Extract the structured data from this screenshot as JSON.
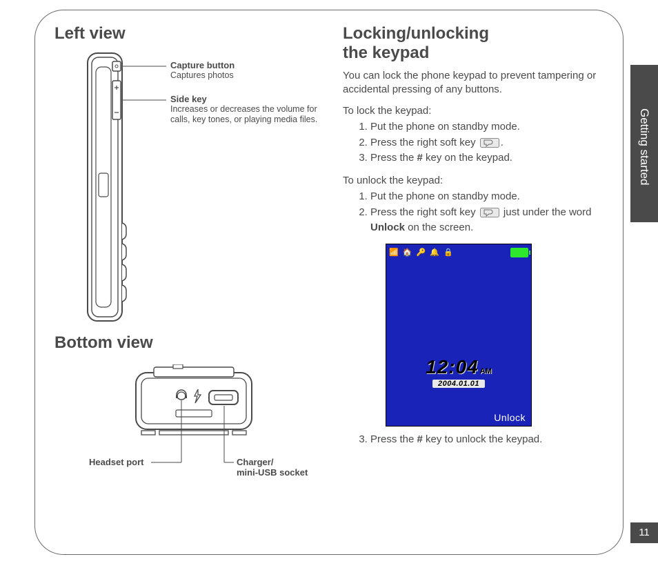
{
  "side_tab": "Getting started",
  "page_number": "11",
  "left_col": {
    "heading_left_view": "Left view",
    "capture": {
      "title": "Capture button",
      "desc": "Captures photos"
    },
    "side_key": {
      "title": "Side key",
      "desc": "Increases or decreases the volume for calls, key tones, or playing media files."
    },
    "heading_bottom_view": "Bottom view",
    "headset_port_label": "Headset port",
    "charger_label_line1": "Charger/",
    "charger_label_line2": "mini-USB socket"
  },
  "right_col": {
    "heading_line1": "Locking/unlocking",
    "heading_line2": "the keypad",
    "intro": "You can lock the phone keypad to prevent tampering or accidental pressing of any buttons.",
    "lock_intro": "To lock the keypad:",
    "lock_steps": {
      "s1": "Put the phone on standby mode.",
      "s2_a": "Press the right soft key ",
      "s2_b": ".",
      "s3_a": "Press the ",
      "s3_key": "#",
      "s3_b": " key on the keypad."
    },
    "unlock_intro": "To unlock the keypad:",
    "unlock_steps": {
      "s1": "Put the phone on standby mode.",
      "s2_a": "Press the right soft key ",
      "s2_b": " just under the word ",
      "s2_bold": "Unlock",
      "s2_c": " on the screen."
    },
    "after_image_step": {
      "s3_a": "Press the ",
      "s3_key": "#",
      "s3_b": " key to unlock the keypad."
    },
    "screen": {
      "time": "12:04",
      "ampm": "AM",
      "date": "2004.01.01",
      "softlabel": "Unlock"
    }
  }
}
